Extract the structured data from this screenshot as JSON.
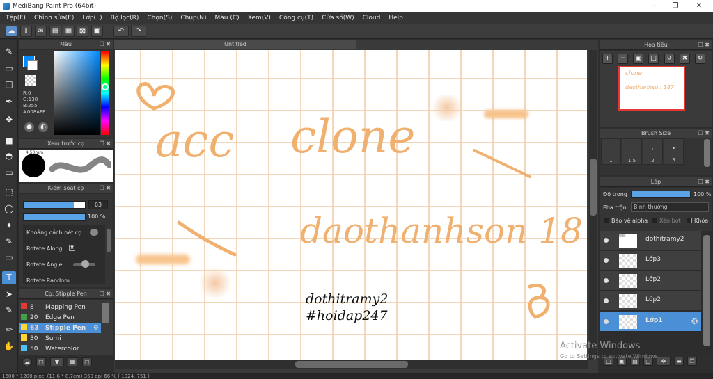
{
  "window": {
    "title": "MediBang Paint Pro (64bit)"
  },
  "menu": [
    "Tệp(F)",
    "Chỉnh sửa(E)",
    "Lớp(L)",
    "Bộ lọc(R)",
    "Chọn(S)",
    "Chụp(N)",
    "Màu (C)",
    "Xem(V)",
    "Công cụ(T)",
    "Cửa sổ(W)",
    "Cloud",
    "Help"
  ],
  "color_panel": {
    "title": "Màu",
    "r": "R:0",
    "g": "G:138",
    "b": "B:255",
    "hex": "#008AFF",
    "fg_color": "#008aff"
  },
  "preview_panel": {
    "title": "Xem trước cọ",
    "size": "4.50mm"
  },
  "brush_control": {
    "title": "Kiểm soát cọ",
    "size_value": "63",
    "opacity_value": "100 %",
    "opt1": "Khoảng cách nét cọ",
    "opt2": "Rotate Along",
    "opt3": "Rotate Angle",
    "opt4": "Rotate Random"
  },
  "brush_list": {
    "title": "Cọ: Stipple Pen",
    "items": [
      {
        "num": "8",
        "name": "Mapping Pen",
        "color": "#e53935"
      },
      {
        "num": "20",
        "name": "Edge Pen",
        "color": "#43a047"
      },
      {
        "num": "63",
        "name": "Stipple Pen",
        "color": "#fdd835"
      },
      {
        "num": "30",
        "name": "Sumi",
        "color": "#fdd835"
      },
      {
        "num": "50",
        "name": "Watercolor",
        "color": "#4fc3f7"
      }
    ]
  },
  "document": {
    "tab": "Untitled"
  },
  "canvas_text": {
    "acc": "acc",
    "clone": "clone",
    "name": "daothanhson 187",
    "ink1": "dothitramy2",
    "ink2": "#hoidap247"
  },
  "navigator": {
    "title": "Hoa tiêu"
  },
  "brush_size": {
    "title": "Brush Size",
    "sizes": [
      "1",
      "1.5",
      "2",
      "3"
    ]
  },
  "layer_panel": {
    "title": "Lớp",
    "opacity_label": "Độ trong",
    "opacity_value": "100 %",
    "blend_label": "Pha trộn",
    "blend_value": "Bình thường",
    "protect_alpha": "Bảo vệ alpha",
    "clipping": "Xén bớt",
    "lock": "Khóa",
    "layers": [
      {
        "name": "dothitramy2",
        "selected": false
      },
      {
        "name": "Lớp3",
        "selected": false
      },
      {
        "name": "Lớp2",
        "selected": false
      },
      {
        "name": "Lớp2",
        "selected": false
      },
      {
        "name": "Lớp1",
        "selected": true
      }
    ]
  },
  "watermark": {
    "line1": "Activate Windows",
    "line2": "Go to Settings to activate Windows."
  },
  "status": {
    "text": "1600 * 1200 pixel   (11.6 * 8.7cm)   350 dpi   66 %   ( 1024, 751 )"
  }
}
